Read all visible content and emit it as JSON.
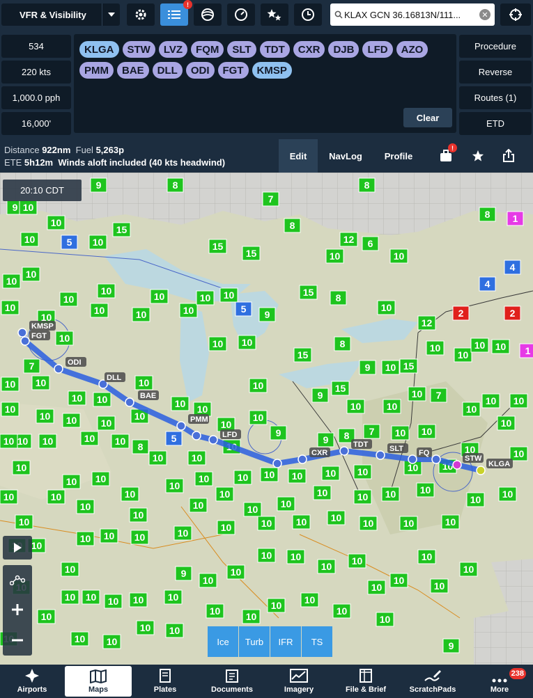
{
  "toolbar": {
    "layer_label": "VFR & Visibility",
    "list_badge": "!",
    "search_value": "KLAX GCN 36.16813N/111..."
  },
  "params": {
    "altitude_code": "534",
    "speed": "220 kts",
    "fuel_flow": "1,000.0 pph",
    "altitude": "16,000'"
  },
  "route": {
    "waypoints": [
      "KLGA",
      "STW",
      "LVZ",
      "FQM",
      "SLT",
      "TDT",
      "CXR",
      "DJB",
      "LFD",
      "AZO",
      "PMM",
      "BAE",
      "DLL",
      "ODI",
      "FGT",
      "KMSP"
    ],
    "clear_label": "Clear"
  },
  "actions": {
    "procedure": "Procedure",
    "reverse": "Reverse",
    "routes": "Routes (1)",
    "etd": "ETD"
  },
  "info": {
    "distance_label": "Distance",
    "distance_value": "922nm",
    "fuel_label": "Fuel",
    "fuel_value": "5,263p",
    "ete_label": "ETE",
    "ete_value": "5h12m",
    "winds_text": "Winds aloft included (40 kts headwind)",
    "tabs": {
      "edit": "Edit",
      "navlog": "NavLog",
      "profile": "Profile"
    },
    "pack_badge": "!"
  },
  "map": {
    "time": "20:10 CDT",
    "overlays": [
      "Ice",
      "Turb",
      "IFR",
      "TS"
    ],
    "visibility_boxes": [
      {
        "value": "8",
        "color": "green"
      },
      {
        "value": "9",
        "color": "green"
      },
      {
        "value": "10",
        "color": "green"
      },
      {
        "value": "15",
        "color": "green"
      },
      {
        "value": "12",
        "color": "green"
      },
      {
        "value": "6",
        "color": "green"
      },
      {
        "value": "7",
        "color": "green"
      },
      {
        "value": "5",
        "color": "blue"
      },
      {
        "value": "4",
        "color": "blue"
      },
      {
        "value": "2",
        "color": "red"
      },
      {
        "value": "1",
        "color": "magenta"
      }
    ],
    "labels": [
      "KMSP",
      "FGT",
      "ODI",
      "DLL",
      "BAE",
      "PMM",
      "LFD",
      "CXR",
      "TDT",
      "SLT",
      "FQ",
      "STW",
      "KLGA"
    ]
  },
  "colors": {
    "accent": "#3a8fdc",
    "chip": "#a9a6e3",
    "chip_endpoint": "#8fc1f0",
    "route_line": "#2a5fe0",
    "vis_green": "#1ec41e",
    "vis_blue": "#2f6fe0",
    "vis_red": "#e0201c",
    "vis_magenta": "#e63ae6"
  },
  "nav": {
    "airports": "Airports",
    "maps": "Maps",
    "plates": "Plates",
    "documents": "Documents",
    "imagery": "Imagery",
    "file_brief": "File & Brief",
    "scratchpads": "ScratchPads",
    "more": "More",
    "more_badge": "238"
  }
}
